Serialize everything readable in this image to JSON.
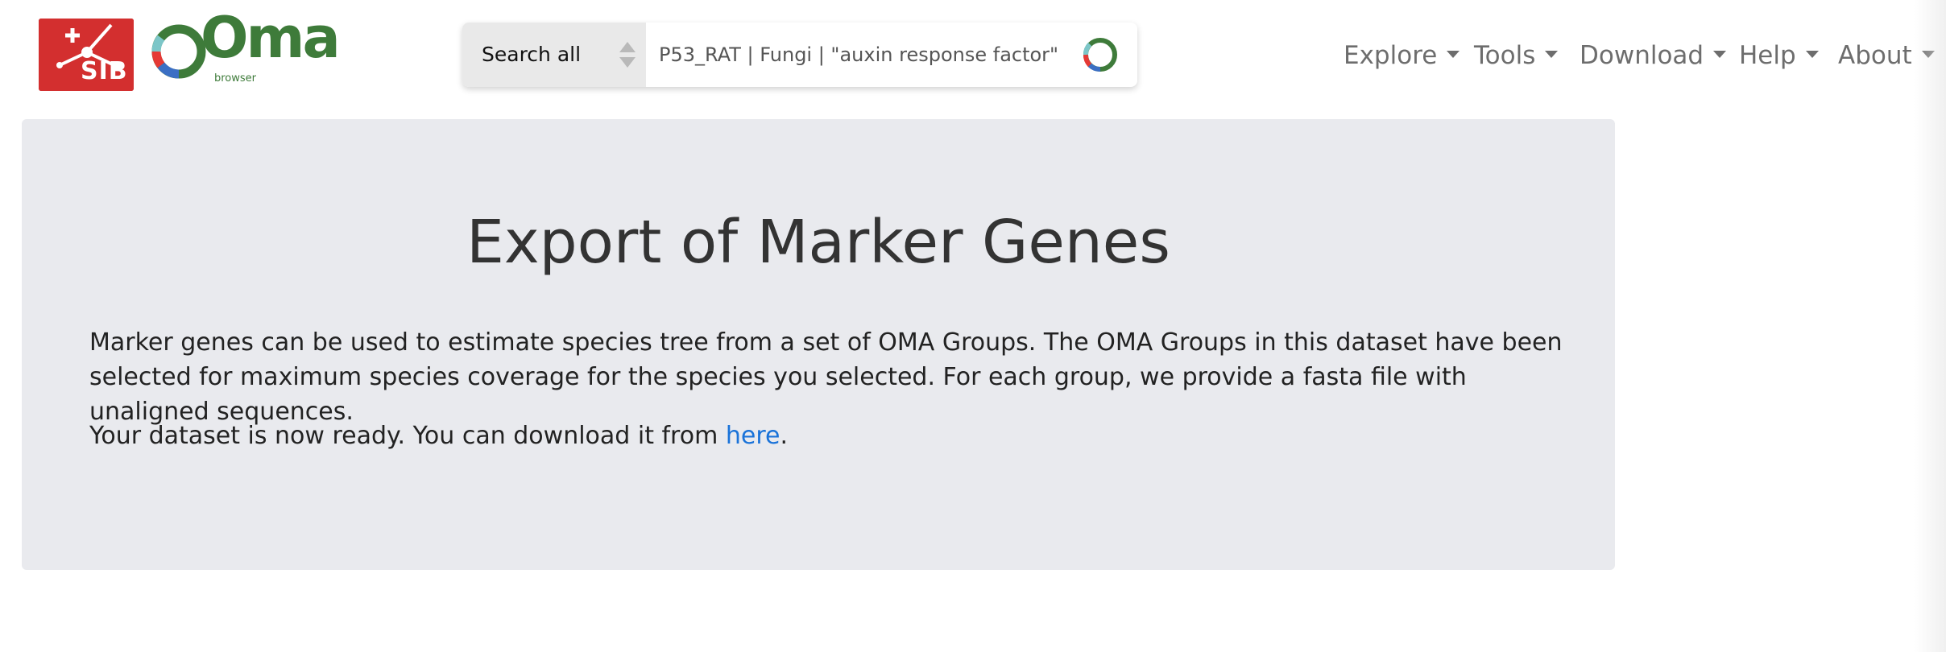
{
  "header": {
    "sib_logo_text": "SIB",
    "oma_logo_text": "Oma",
    "oma_logo_subtext": "browser"
  },
  "search": {
    "scope_label": "Search all",
    "placeholder": "P53_RAT | Fungi | \"auxin response factor\""
  },
  "nav": {
    "items": [
      {
        "label": "Explore"
      },
      {
        "label": "Tools"
      },
      {
        "label": "Download"
      },
      {
        "label": "Help"
      },
      {
        "label": "About"
      }
    ]
  },
  "main": {
    "title": "Export of Marker Genes",
    "description": "Marker genes can be used to estimate species tree from a set of OMA Groups. The OMA Groups in this dataset have been selected for maximum species coverage for the species you selected. For each group, we provide a fasta file with unaligned sequences.",
    "ready_prefix": "Your dataset is now ready. You can download it from ",
    "ready_link": "here",
    "ready_suffix": "."
  },
  "colors": {
    "sib_red": "#d32f2f",
    "oma_green": "#3e7b3a",
    "link_blue": "#1a73d9",
    "jumbotron_bg": "#e9eaee"
  }
}
